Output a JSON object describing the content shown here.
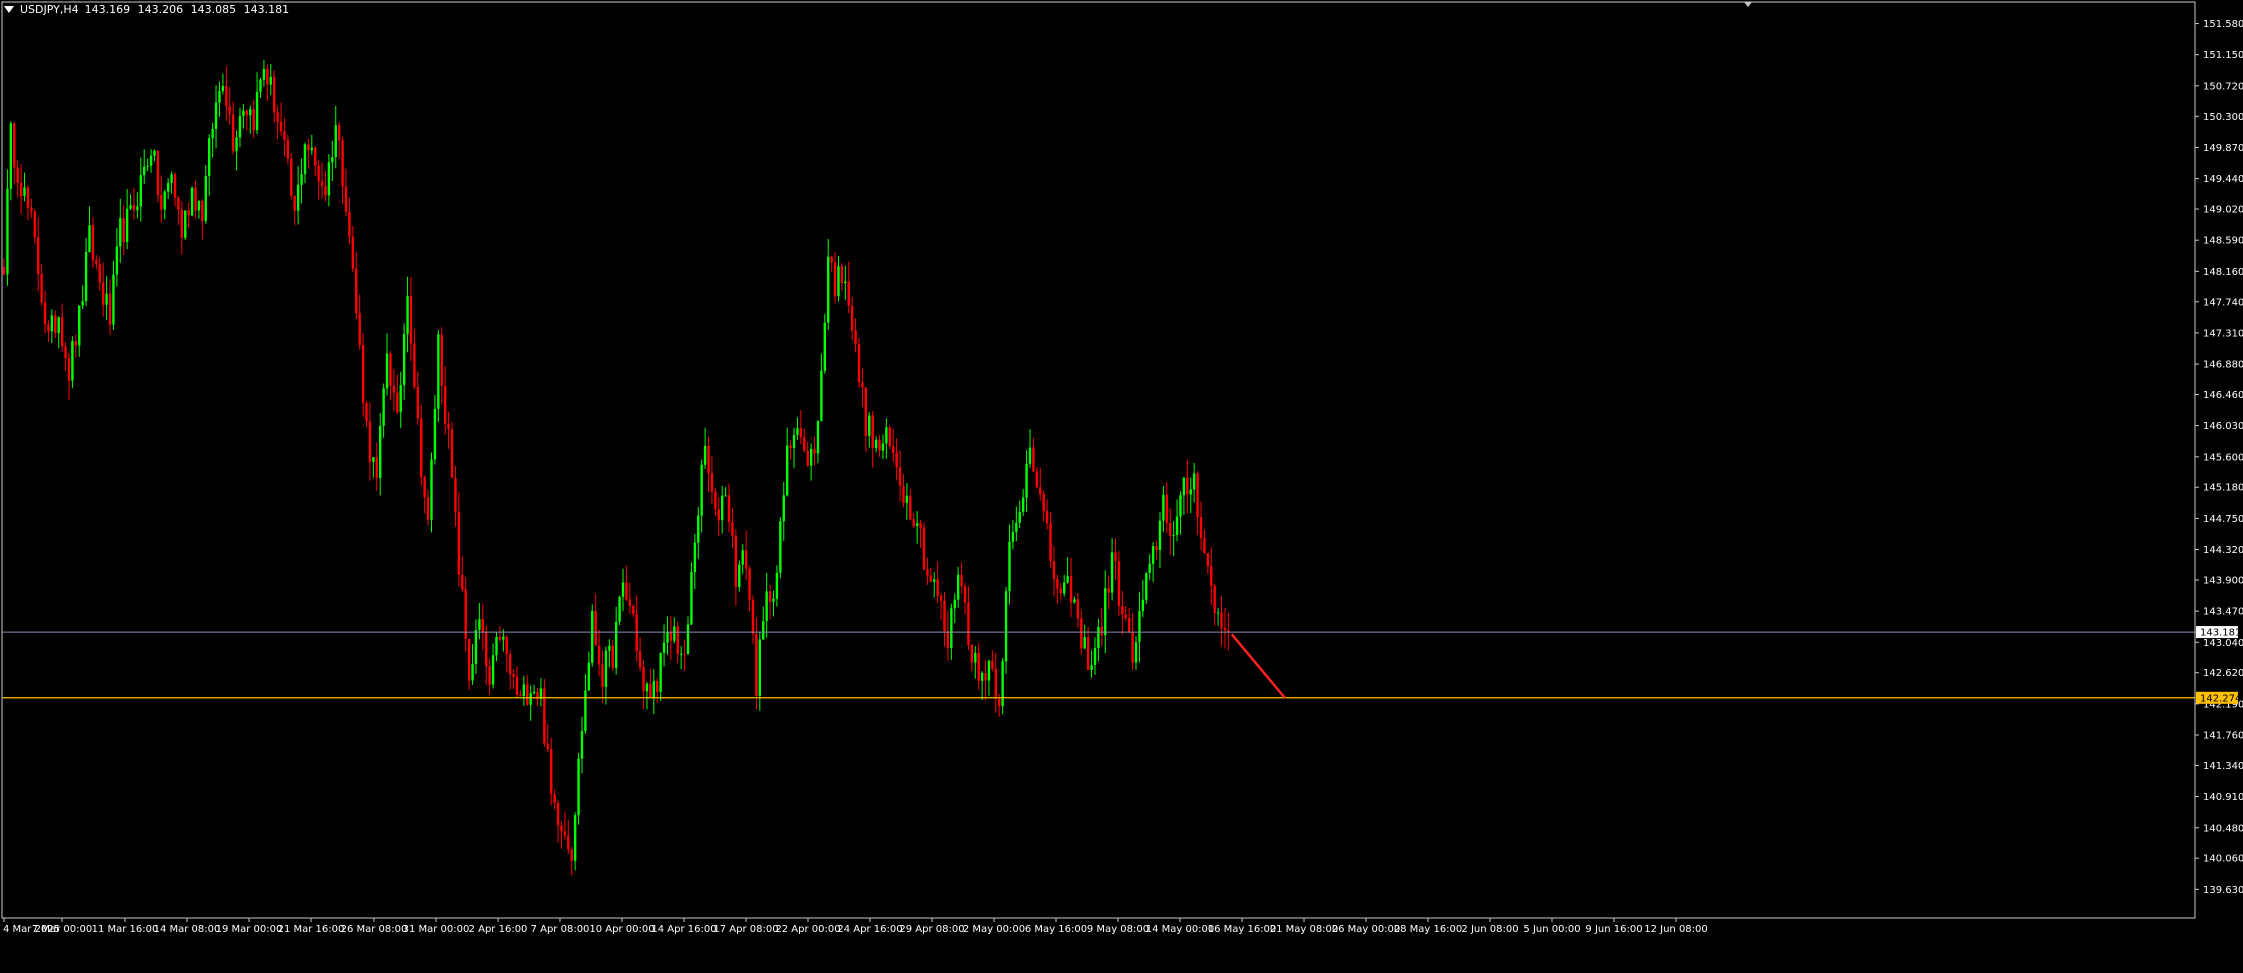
{
  "header": {
    "symbol": "USDJPY,H4",
    "open": "143.169",
    "high": "143.206",
    "low": "143.085",
    "close": "143.181"
  },
  "colors": {
    "background": "#000000",
    "frame": "#c8c8c8",
    "bull": "#00ff00",
    "bear": "#ff0000",
    "bid_line": "#8a8fb5",
    "level_line": "#ffc000",
    "projection": "#ff2020",
    "text": "#ffffff"
  },
  "chart_data": {
    "type": "candlestick",
    "instrument": "USDJPY",
    "timeframe": "H4",
    "ylim": [
      139.4,
      151.85
    ],
    "y_ticks": [
      "151.580",
      "151.150",
      "150.720",
      "150.300",
      "149.870",
      "149.440",
      "149.020",
      "148.590",
      "148.160",
      "147.740",
      "147.310",
      "146.880",
      "146.460",
      "146.030",
      "145.600",
      "145.180",
      "144.750",
      "144.320",
      "143.900",
      "143.470",
      "143.040",
      "142.620",
      "142.190",
      "141.760",
      "141.340",
      "140.910",
      "140.480",
      "140.060",
      "139.630"
    ],
    "x_ticks": [
      "4 Mar 2025",
      "7 Mar 00:00",
      "11 Mar 16:00",
      "14 Mar 08:00",
      "19 Mar 00:00",
      "21 Mar 16:00",
      "26 Mar 08:00",
      "31 Mar 00:00",
      "2 Apr 16:00",
      "7 Apr 08:00",
      "10 Apr 00:00",
      "14 Apr 16:00",
      "17 Apr 08:00",
      "22 Apr 00:00",
      "24 Apr 16:00",
      "29 Apr 08:00",
      "2 May 00:00",
      "6 May 16:00",
      "9 May 08:00",
      "14 May 00:00",
      "16 May 16:00",
      "21 May 08:00",
      "26 May 00:00",
      "28 May 16:00",
      "2 Jun 08:00",
      "5 Jun 00:00",
      "9 Jun 16:00",
      "12 Jun 08:00"
    ],
    "waypoints": [
      [
        0,
        148.3
      ],
      [
        2,
        150.0
      ],
      [
        5,
        149.4
      ],
      [
        8,
        148.8
      ],
      [
        10,
        148.2
      ],
      [
        13,
        147.2
      ],
      [
        16,
        147.6
      ],
      [
        19,
        146.8
      ],
      [
        22,
        147.5
      ],
      [
        25,
        148.6
      ],
      [
        28,
        148.0
      ],
      [
        31,
        147.5
      ],
      [
        34,
        148.7
      ],
      [
        37,
        148.9
      ],
      [
        40,
        149.4
      ],
      [
        43,
        149.9
      ],
      [
        46,
        149.0
      ],
      [
        49,
        149.5
      ],
      [
        52,
        148.7
      ],
      [
        55,
        149.3
      ],
      [
        58,
        149.0
      ],
      [
        61,
        150.2
      ],
      [
        64,
        150.9
      ],
      [
        67,
        150.0
      ],
      [
        70,
        150.5
      ],
      [
        73,
        150.3
      ],
      [
        76,
        151.0
      ],
      [
        79,
        150.5
      ],
      [
        82,
        149.8
      ],
      [
        85,
        148.9
      ],
      [
        88,
        150.0
      ],
      [
        91,
        149.6
      ],
      [
        94,
        149.3
      ],
      [
        97,
        150.2
      ],
      [
        100,
        149.2
      ],
      [
        103,
        147.6
      ],
      [
        106,
        146.0
      ],
      [
        109,
        145.2
      ],
      [
        112,
        147.1
      ],
      [
        115,
        146.0
      ],
      [
        118,
        148.0
      ],
      [
        121,
        146.0
      ],
      [
        124,
        144.6
      ],
      [
        127,
        147.2
      ],
      [
        130,
        145.8
      ],
      [
        133,
        144.1
      ],
      [
        136,
        142.6
      ],
      [
        139,
        143.3
      ],
      [
        142,
        142.4
      ],
      [
        145,
        143.2
      ],
      [
        148,
        142.6
      ],
      [
        151,
        142.2
      ],
      [
        154,
        142.5
      ],
      [
        157,
        142.3
      ],
      [
        160,
        140.9
      ],
      [
        163,
        140.6
      ],
      [
        166,
        140.2
      ],
      [
        169,
        141.9
      ],
      [
        172,
        143.3
      ],
      [
        175,
        142.6
      ],
      [
        178,
        142.9
      ],
      [
        181,
        143.8
      ],
      [
        184,
        143.4
      ],
      [
        187,
        142.3
      ],
      [
        190,
        142.4
      ],
      [
        193,
        142.9
      ],
      [
        196,
        143.2
      ],
      [
        199,
        142.7
      ],
      [
        202,
        144.5
      ],
      [
        205,
        145.7
      ],
      [
        208,
        144.7
      ],
      [
        211,
        145.2
      ],
      [
        214,
        144.0
      ],
      [
        217,
        144.2
      ],
      [
        220,
        142.5
      ],
      [
        223,
        143.6
      ],
      [
        226,
        144.0
      ],
      [
        229,
        145.6
      ],
      [
        232,
        146.2
      ],
      [
        235,
        145.4
      ],
      [
        238,
        146.0
      ],
      [
        241,
        148.4
      ],
      [
        243,
        148.0
      ],
      [
        246,
        148.2
      ],
      [
        249,
        147.0
      ],
      [
        252,
        146.1
      ],
      [
        255,
        145.7
      ],
      [
        258,
        145.8
      ],
      [
        261,
        145.5
      ],
      [
        264,
        145.0
      ],
      [
        267,
        144.8
      ],
      [
        270,
        144.0
      ],
      [
        273,
        143.7
      ],
      [
        276,
        143.0
      ],
      [
        279,
        144.1
      ],
      [
        282,
        143.2
      ],
      [
        285,
        142.5
      ],
      [
        288,
        142.8
      ],
      [
        291,
        142.3
      ],
      [
        294,
        144.3
      ],
      [
        297,
        144.8
      ],
      [
        300,
        145.9
      ],
      [
        303,
        145.0
      ],
      [
        306,
        144.2
      ],
      [
        309,
        143.6
      ],
      [
        312,
        143.8
      ],
      [
        315,
        143.0
      ],
      [
        318,
        142.8
      ],
      [
        321,
        143.3
      ],
      [
        324,
        144.2
      ],
      [
        327,
        143.5
      ],
      [
        330,
        142.8
      ],
      [
        333,
        143.6
      ],
      [
        336,
        144.2
      ],
      [
        339,
        145.0
      ],
      [
        342,
        144.5
      ],
      [
        345,
        145.1
      ],
      [
        348,
        145.3
      ],
      [
        351,
        144.3
      ],
      [
        354,
        143.5
      ],
      [
        356,
        143.3
      ],
      [
        358,
        143.18
      ]
    ],
    "bid_price": 143.181,
    "bid_label": "143.181",
    "level_price": 142.274,
    "level_label": "142.274",
    "projection": {
      "from_bar": 359,
      "from_price": 143.15,
      "to_bar": 371,
      "to_price": 142.274
    }
  }
}
